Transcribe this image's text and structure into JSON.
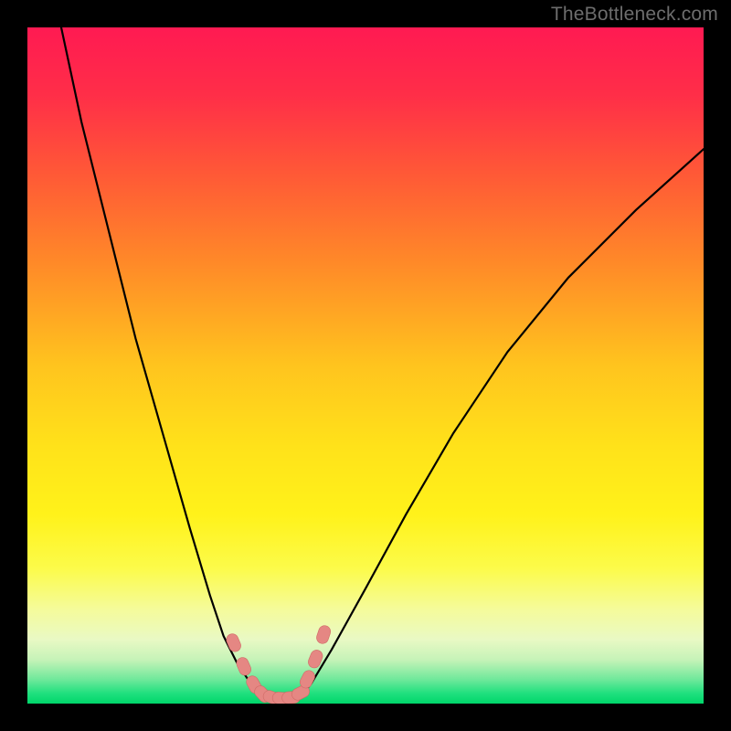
{
  "watermark": "TheBottleneck.com",
  "colors": {
    "black": "#000000",
    "curve": "#000000",
    "marker_fill": "#e58783",
    "marker_stroke": "#d06a66"
  },
  "gradient_stops": [
    {
      "offset": 0.0,
      "color": "#ff1a52"
    },
    {
      "offset": 0.1,
      "color": "#ff2e48"
    },
    {
      "offset": 0.22,
      "color": "#ff5a36"
    },
    {
      "offset": 0.35,
      "color": "#ff8a28"
    },
    {
      "offset": 0.5,
      "color": "#ffc41e"
    },
    {
      "offset": 0.62,
      "color": "#ffe21a"
    },
    {
      "offset": 0.72,
      "color": "#fff21a"
    },
    {
      "offset": 0.8,
      "color": "#fcfb4a"
    },
    {
      "offset": 0.86,
      "color": "#f5fb9a"
    },
    {
      "offset": 0.905,
      "color": "#e9f9c4"
    },
    {
      "offset": 0.935,
      "color": "#c6f3b8"
    },
    {
      "offset": 0.965,
      "color": "#6de89a"
    },
    {
      "offset": 0.985,
      "color": "#1fe07e"
    },
    {
      "offset": 1.0,
      "color": "#00d66a"
    }
  ],
  "chart_data": {
    "type": "line",
    "title": "",
    "xlabel": "",
    "ylabel": "",
    "xlim": [
      0,
      100
    ],
    "ylim": [
      0,
      100
    ],
    "grid": false,
    "legend": false,
    "series": [
      {
        "name": "left-curve",
        "x": [
          5,
          8,
          12,
          16,
          20,
          24,
          27,
          29,
          31,
          33,
          34,
          35
        ],
        "y": [
          100,
          86,
          70,
          54,
          40,
          26,
          16,
          10,
          6,
          3,
          1.5,
          0.5
        ]
      },
      {
        "name": "right-curve",
        "x": [
          40,
          42,
          45,
          50,
          56,
          63,
          71,
          80,
          90,
          100
        ],
        "y": [
          0.5,
          3,
          8,
          17,
          28,
          40,
          52,
          63,
          73,
          82
        ]
      },
      {
        "name": "markers",
        "x": [
          30.5,
          32.0,
          33.5,
          34.8,
          36.2,
          37.6,
          39.0,
          40.4,
          41.4,
          42.6,
          43.8
        ],
        "y": [
          9.0,
          5.5,
          2.8,
          1.4,
          0.9,
          0.8,
          0.9,
          1.6,
          3.6,
          6.6,
          10.2
        ]
      }
    ]
  }
}
